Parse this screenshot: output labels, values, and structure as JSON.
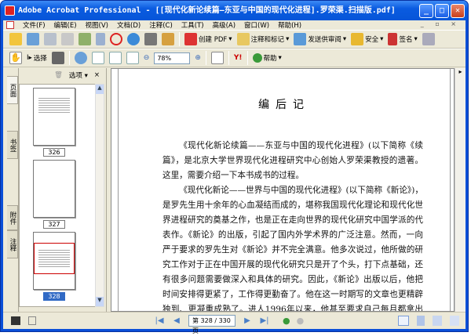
{
  "window": {
    "title": "Adobe Acrobat Professional - [[现代化新论续篇—东亚与中国的现代化进程].罗荣渠.扫描版.pdf]",
    "min": "_",
    "max": "□",
    "close": "✕"
  },
  "menu": [
    "文件(F)",
    "编辑(E)",
    "视图(V)",
    "文档(D)",
    "注释(C)",
    "工具(T)",
    "高级(A)",
    "窗口(W)",
    "帮助(H)"
  ],
  "toolbar1": {
    "create_pdf": "创建 PDF",
    "comment": "注释和标记",
    "review": "发送供审阅",
    "security": "安全",
    "sign": "签名"
  },
  "toolbar2": {
    "select": "选择",
    "zoom": "78%",
    "help": "帮助"
  },
  "side_tabs": [
    "页面",
    "书签",
    "附件",
    "注释"
  ],
  "panel": {
    "options": "选项",
    "close": "×"
  },
  "thumbnails": [
    {
      "label": "326"
    },
    {
      "label": "327"
    },
    {
      "label": "328",
      "selected": true
    }
  ],
  "document": {
    "title": "编后记",
    "paragraphs": [
      "《现代化新论续篇——东亚与中国的现代化进程》(以下简称《续篇》，是北京大学世界现代化进程研究中心创始人罗荣渠教授的遗著。这里，需要介绍一下本书成书的过程。",
      "《现代化新论——世界与中国的现代化进程》(以下简称《新论》)，是罗先生用十余年的心血凝结而成的，堪称我国现代化理论和现代化世界进程研究的奠基之作，也是正在走向世界的现代化研究中国学派的代表作。《新论》的出版，引起了国内外学术界的广泛注意。然而，一向严于要求的罗先生对《新论》并不完全满意。他多次说过，他所做的研究工作对于正在中国开展的现代化研究只是开了个头，打下点基础，还有很多问题需要做深入和具体的研究。因此，《新论》出版以后，他把时间安排得更紧了，工作得更勤奋了。他在这一时期写的文章也更精辟独到、更凝重成熟了。进人1996年以来，他甚至要求自己每月都拿出一篇像样的文章来，新成果接连问世。他满怀信心地说，再加一把力，补"
    ]
  },
  "status": {
    "page": "第 328 / 330 页"
  }
}
